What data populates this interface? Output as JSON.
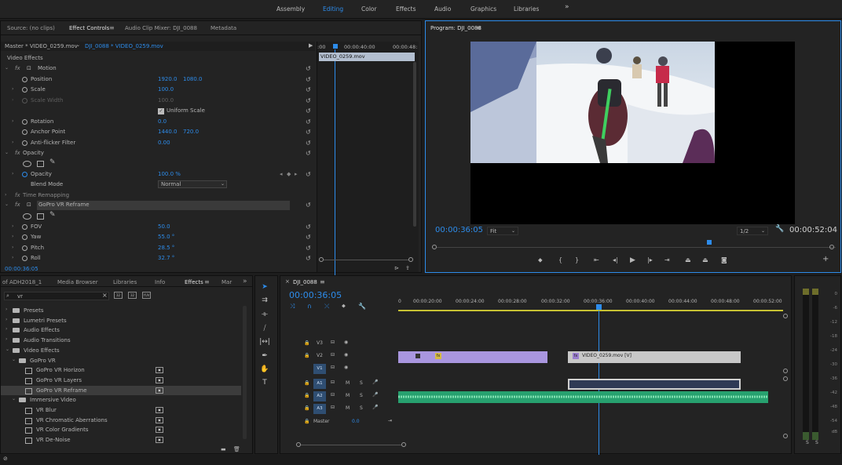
{
  "workspaces": [
    "Assembly",
    "Editing",
    "Color",
    "Effects",
    "Audio",
    "Graphics",
    "Libraries"
  ],
  "workspaces_more": "»",
  "source_panel": {
    "tabs": [
      "Source: (no clips)",
      "Effect Controls",
      "Audio Clip Mixer: DJI_0088",
      "Metadata"
    ],
    "tab_menu": "≡",
    "master_label": "Master * VIDEO_0259.mov",
    "seq_label": "DJI_0088 * VIDEO_0259.mov",
    "timecode_left": ":00",
    "timecode_mid": "00:00:40:00",
    "timecode_right": "00:00:48:",
    "clip_label": "VIDEO_0259.mov",
    "section_video_effects": "Video Effects",
    "motion": "Motion",
    "position_label": "Position",
    "position_x": "1920.0",
    "position_y": "1080.0",
    "scale_label": "Scale",
    "scale_val": "100.0",
    "scale_width_label": "Scale Width",
    "scale_width_val": "100.0",
    "uniform_scale": "Uniform Scale",
    "rotation_label": "Rotation",
    "rotation_val": "0.0",
    "anchor_label": "Anchor Point",
    "anchor_x": "1440.0",
    "anchor_y": "720.0",
    "antiflicker_label": "Anti-flicker Filter",
    "antiflicker_val": "0.00",
    "opacity_section": "Opacity",
    "opacity_label": "Opacity",
    "opacity_val": "100.0 %",
    "blend_label": "Blend Mode",
    "blend_val": "Normal",
    "time_remap": "Time Remapping",
    "gopro_reframe": "GoPro VR Reframe",
    "fov_label": "FOV",
    "fov_val": "50.0",
    "yaw_label": "Yaw",
    "yaw_val": "55.0 °",
    "pitch_label": "Pitch",
    "pitch_val": "28.5 °",
    "roll_label": "Roll",
    "roll_val": "32.7 °",
    "current_time": "00:00:36:05"
  },
  "program_panel": {
    "title": "Program: DJI_0088",
    "title_menu": "≡",
    "timecode": "00:00:36:05",
    "fit": "Fit",
    "resolution": "1/2",
    "duration": "00:00:52:04"
  },
  "project_panel": {
    "tabs": [
      "of ADH2018_1",
      "Media Browser",
      "Libraries",
      "Info",
      "Effects",
      "Mar"
    ],
    "more": "»",
    "search_value": "vr",
    "search_clear": "×",
    "items": [
      {
        "label": "Presets",
        "indent": 0,
        "type": "folder",
        "tw": "›"
      },
      {
        "label": "Lumetri Presets",
        "indent": 0,
        "type": "folder",
        "tw": "›"
      },
      {
        "label": "Audio Effects",
        "indent": 0,
        "type": "folder",
        "tw": "›"
      },
      {
        "label": "Audio Transitions",
        "indent": 0,
        "type": "folder",
        "tw": "›"
      },
      {
        "label": "Video Effects",
        "indent": 0,
        "type": "folder",
        "tw": "⌄"
      },
      {
        "label": "GoPro VR",
        "indent": 1,
        "type": "folder",
        "tw": "⌄"
      },
      {
        "label": "GoPro VR Horizon",
        "indent": 2,
        "type": "effect",
        "tw": ""
      },
      {
        "label": "GoPro VR Layers",
        "indent": 2,
        "type": "effect",
        "tw": ""
      },
      {
        "label": "GoPro VR Reframe",
        "indent": 2,
        "type": "effect",
        "tw": "",
        "selected": true
      },
      {
        "label": "Immersive Video",
        "indent": 1,
        "type": "folder",
        "tw": "⌄"
      },
      {
        "label": "VR Blur",
        "indent": 2,
        "type": "effect",
        "tw": ""
      },
      {
        "label": "VR Chromatic Aberrations",
        "indent": 2,
        "type": "effect",
        "tw": ""
      },
      {
        "label": "VR Color Gradients",
        "indent": 2,
        "type": "effect",
        "tw": ""
      },
      {
        "label": "VR De-Noise",
        "indent": 2,
        "type": "effect",
        "tw": ""
      }
    ]
  },
  "timeline": {
    "seq_name": "DJI_0088",
    "seq_menu": "≡",
    "timecode": "00:00:36:05",
    "ruler": [
      "00:00:20:00",
      "00:00:24:00",
      "00:00:28:00",
      "00:00:32:00",
      "00:00:36:00",
      "00:00:40:00",
      "00:00:44:00",
      "00:00:48:00",
      "00:00:52:00"
    ],
    "ruler_start": "0",
    "tracks_video": [
      "V3",
      "V2",
      "V1"
    ],
    "tracks_audio": [
      "A1",
      "A2",
      "A3"
    ],
    "master_label": "Master",
    "master_val": "0.0",
    "clip_v2_label": "VIDEO_0259.mov [V]",
    "fx_badge": "fx",
    "mute": "M",
    "solo": "S"
  },
  "meter": {
    "ticks": [
      "0",
      "-6",
      "-12",
      "-18",
      "-24",
      "-30",
      "-36",
      "-42",
      "-48",
      "-54",
      "dB"
    ],
    "solo": [
      "S",
      "S"
    ]
  }
}
